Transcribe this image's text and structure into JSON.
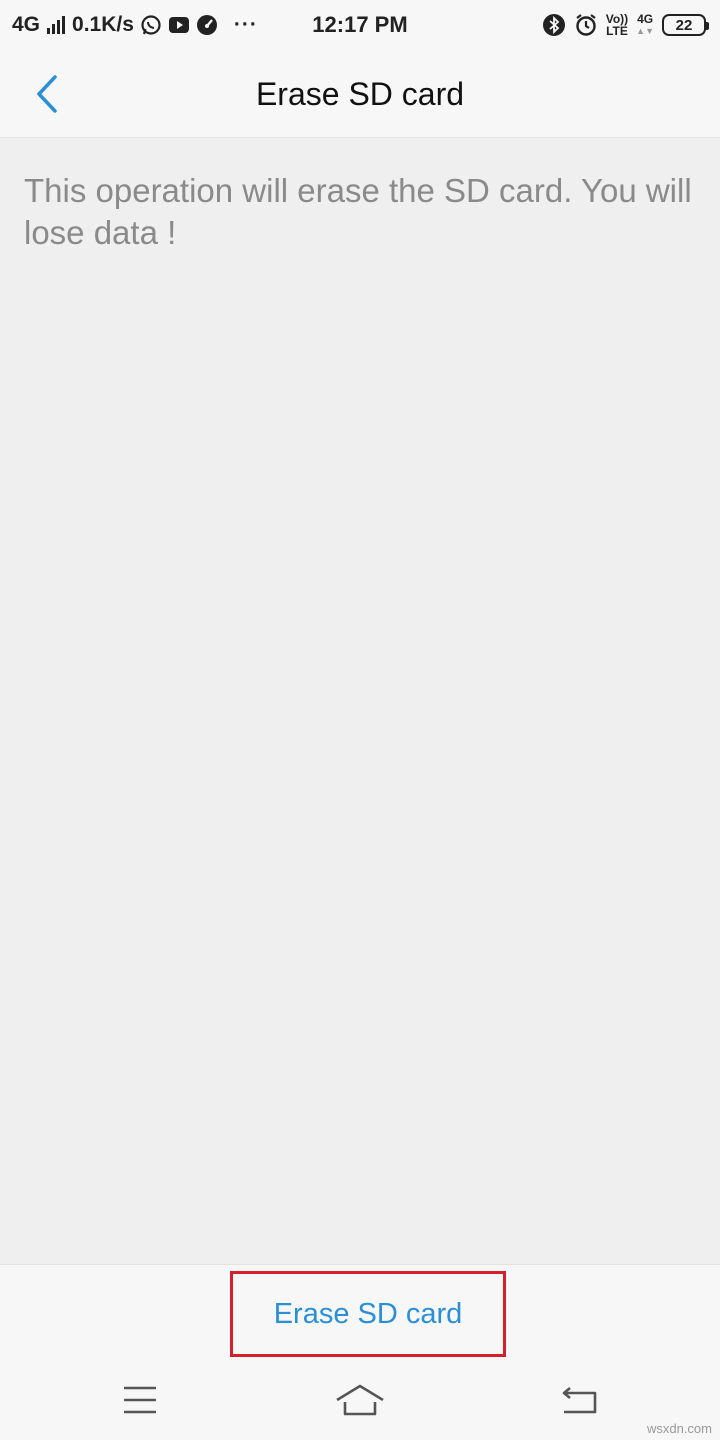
{
  "status_bar": {
    "network": "4G",
    "speed": "0.1K/s",
    "more": "···",
    "time": "12:17 PM",
    "volte_top": "Vo))",
    "volte_bottom": "LTE",
    "net_top": "4G",
    "battery": "22"
  },
  "header": {
    "title": "Erase SD card"
  },
  "content": {
    "warning": "This operation will erase the SD card. You will lose data !"
  },
  "action": {
    "erase_label": "Erase SD card"
  },
  "watermark": "wsxdn.com",
  "colors": {
    "accent": "#2a8fd6",
    "highlight": "#d4202a",
    "text_muted": "#8a8a8a"
  },
  "icons": [
    "signal-icon",
    "whatsapp-icon",
    "youtube-icon",
    "speedometer-icon",
    "bluetooth-icon",
    "alarm-icon",
    "back-chevron-icon",
    "menu-icon",
    "home-icon",
    "return-icon"
  ]
}
